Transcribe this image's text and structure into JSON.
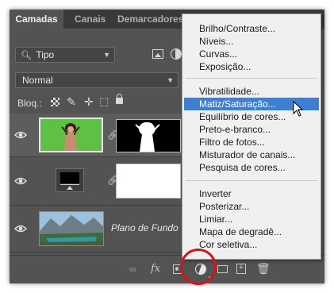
{
  "panel": {
    "tabs": [
      {
        "label": "Camadas",
        "active": true
      },
      {
        "label": "Canais",
        "active": false
      },
      {
        "label": "Demarcadores",
        "active": false
      }
    ],
    "filter": {
      "label": "Tipo",
      "icon": "search-icon"
    },
    "blend_mode": "Normal",
    "lock_label": "Bloq.:",
    "layers": [
      {
        "name": "",
        "type": "hue-saturation-adjustment-with-mask",
        "visible": true,
        "selected": true
      },
      {
        "name": "",
        "type": "levels-adjustment-with-mask",
        "visible": true
      },
      {
        "name": "Plano de Fundo",
        "type": "background-image",
        "visible": true
      }
    ],
    "bottom_icons": [
      "link-layers-icon",
      "fx-icon",
      "add-mask-icon",
      "new-adjustment-layer-icon",
      "new-group-icon",
      "new-layer-icon",
      "delete-icon"
    ],
    "fx_label": "fx"
  },
  "menu": {
    "items": [
      {
        "label": "Brilho/Contraste...",
        "group": 1
      },
      {
        "label": "Níveis...",
        "group": 1
      },
      {
        "label": "Curvas...",
        "group": 1
      },
      {
        "label": "Exposição...",
        "group": 1
      },
      {
        "label": "Vibratilidade...",
        "group": 2
      },
      {
        "label": "Matiz/Saturação...",
        "group": 2,
        "highlighted": true
      },
      {
        "label": "Equilíbrio de cores...",
        "group": 2
      },
      {
        "label": "Preto-e-branco...",
        "group": 2
      },
      {
        "label": "Filtro de fotos...",
        "group": 2
      },
      {
        "label": "Misturador de canais...",
        "group": 2
      },
      {
        "label": "Pesquisa de cores...",
        "group": 2
      },
      {
        "label": "Inverter",
        "group": 3
      },
      {
        "label": "Posterizar...",
        "group": 3
      },
      {
        "label": "Limiar...",
        "group": 3
      },
      {
        "label": "Mapa de degradê...",
        "group": 3
      },
      {
        "label": "Cor seletiva...",
        "group": 3
      }
    ]
  },
  "colors": {
    "panel_bg": "#535353",
    "tabbar_bg": "#393939",
    "menu_bg": "#f0f0f0",
    "menu_highlight": "#3c7fd4",
    "annotation_circle": "#d2141c",
    "green_screen": "#5fbf47"
  }
}
